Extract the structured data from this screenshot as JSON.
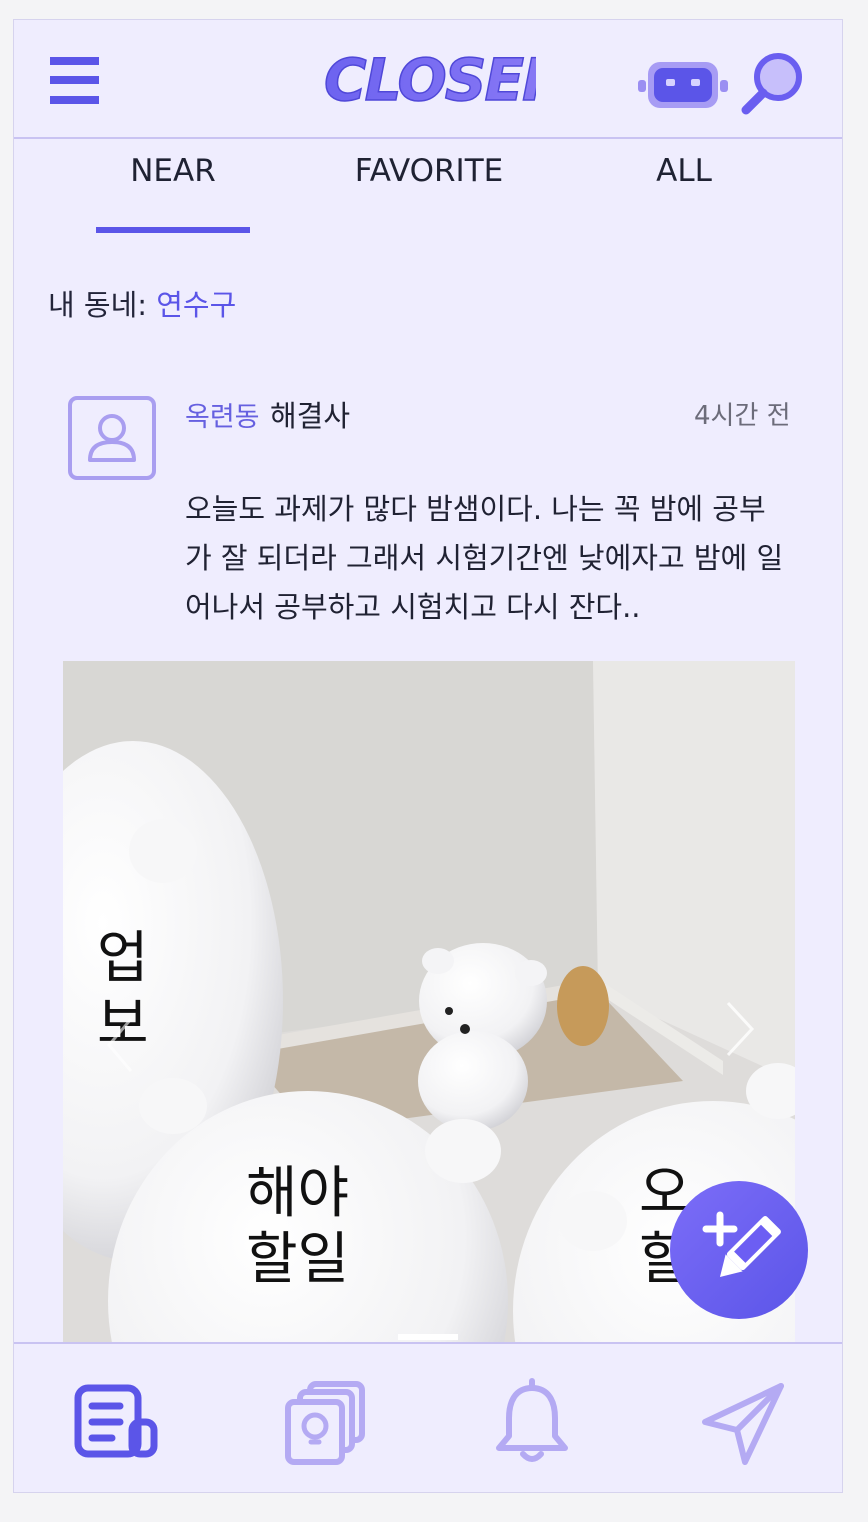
{
  "header": {
    "logo_text": "CLOSER",
    "menu_icon": "hamburger-menu-icon",
    "bot_icon": "robot-icon",
    "search_icon": "search-icon"
  },
  "tabs": [
    {
      "label": "NEAR",
      "active": true
    },
    {
      "label": "FAVORITE",
      "active": false
    },
    {
      "label": "ALL",
      "active": false
    }
  ],
  "neighborhood": {
    "label": "내 동네:",
    "value": "연수구"
  },
  "post": {
    "location": "옥련동",
    "user": "해결사",
    "time": "4시간 전",
    "body": "오늘도 과제가 많다 밤샘이다. 나는 꼭 밤에 공부가 잘 되더라 그래서 시험기간엔 낮에자고 밤에 일어나서 공부하고 시험치고 다시 잔다..",
    "image_texts": [
      "업\n보",
      "해야\n할일",
      "오\n할"
    ]
  },
  "fab_icon": "edit-add-icon",
  "bottom_nav": [
    {
      "icon": "feed-icon",
      "active": true
    },
    {
      "icon": "idea-cards-icon",
      "active": false
    },
    {
      "icon": "bell-icon",
      "active": false
    },
    {
      "icon": "send-icon",
      "active": false
    }
  ],
  "colors": {
    "accent": "#5b55e8",
    "background": "#efedfe",
    "muted_icon": "#b4aaf3"
  }
}
